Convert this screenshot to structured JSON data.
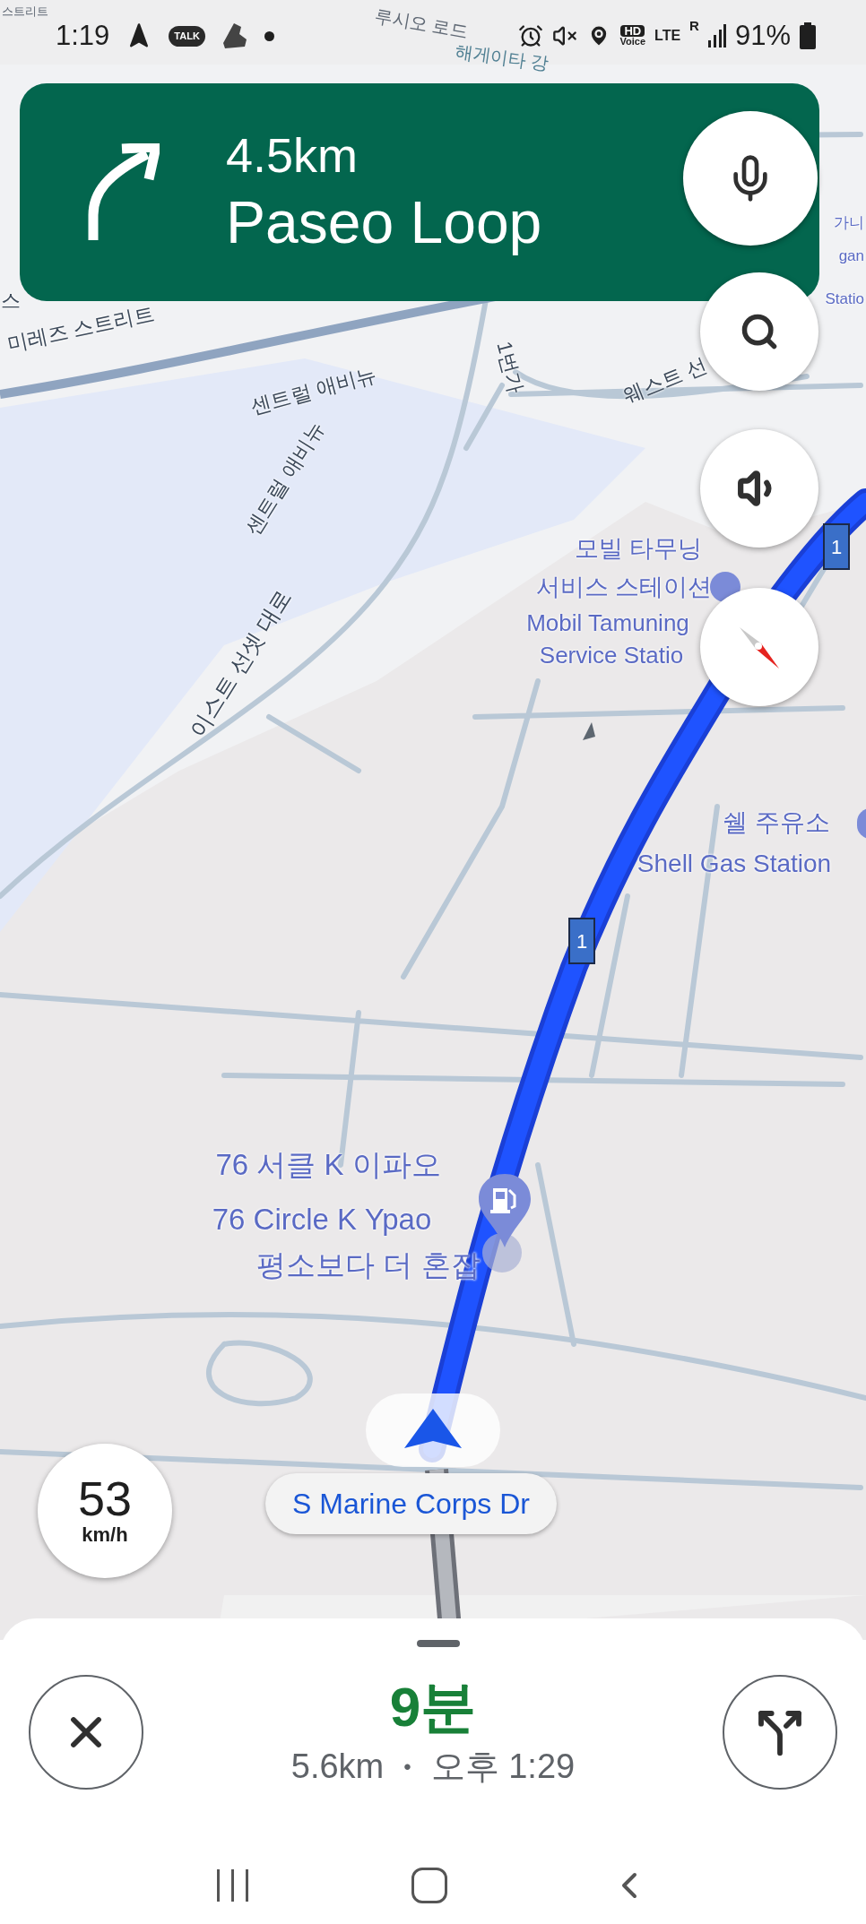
{
  "status_bar": {
    "time": "1:19",
    "talk_badge": "TALK",
    "hd": "HD",
    "voice": "Voice",
    "network": "LTE",
    "roaming": "R",
    "battery": "91%"
  },
  "instruction": {
    "distance": "4.5km",
    "street": "Paseo Loop"
  },
  "map_labels": [
    {
      "kind": "faint",
      "text": "스트리트"
    },
    {
      "kind": "faint",
      "text": "루시오 로드"
    },
    {
      "kind": "water",
      "text": "해게이타 강"
    },
    {
      "kind": "road",
      "text": "스"
    },
    {
      "kind": "road",
      "text": "미레즈 스트리트"
    },
    {
      "kind": "road",
      "text": "센트럴 애비뉴"
    },
    {
      "kind": "road",
      "text": "센트럴 애비뉴"
    },
    {
      "kind": "road",
      "text": "1번가"
    },
    {
      "kind": "road",
      "text": "웨스트 선"
    },
    {
      "kind": "road",
      "text": "이스트 선셋 대로"
    },
    {
      "kind": "poi",
      "text": "가니"
    },
    {
      "kind": "poi",
      "text": "gan"
    },
    {
      "kind": "poi",
      "text": "Statio"
    },
    {
      "kind": "poi",
      "text": "모빌 타무닝"
    },
    {
      "kind": "poi",
      "text": "서비스 스테이션"
    },
    {
      "kind": "poi",
      "text": "Mobil Tamuning"
    },
    {
      "kind": "poi",
      "text": "Service Statio"
    },
    {
      "kind": "poi",
      "text": "쉘 주유소"
    },
    {
      "kind": "poi",
      "text": "Shell Gas Station"
    },
    {
      "kind": "poi",
      "text": "76 서클 K 이파오"
    },
    {
      "kind": "poi",
      "text": "76 Circle K Ypao"
    },
    {
      "kind": "poi",
      "text": "평소보다 더 혼잡"
    }
  ],
  "route_shields": [
    "1",
    "1"
  ],
  "current_street": "S Marine Corps Dr",
  "speed": {
    "value": "53",
    "unit": "km/h"
  },
  "trip": {
    "duration": "9분",
    "distance": "5.6km",
    "separator": "•",
    "arrival": "오후 1:29"
  }
}
